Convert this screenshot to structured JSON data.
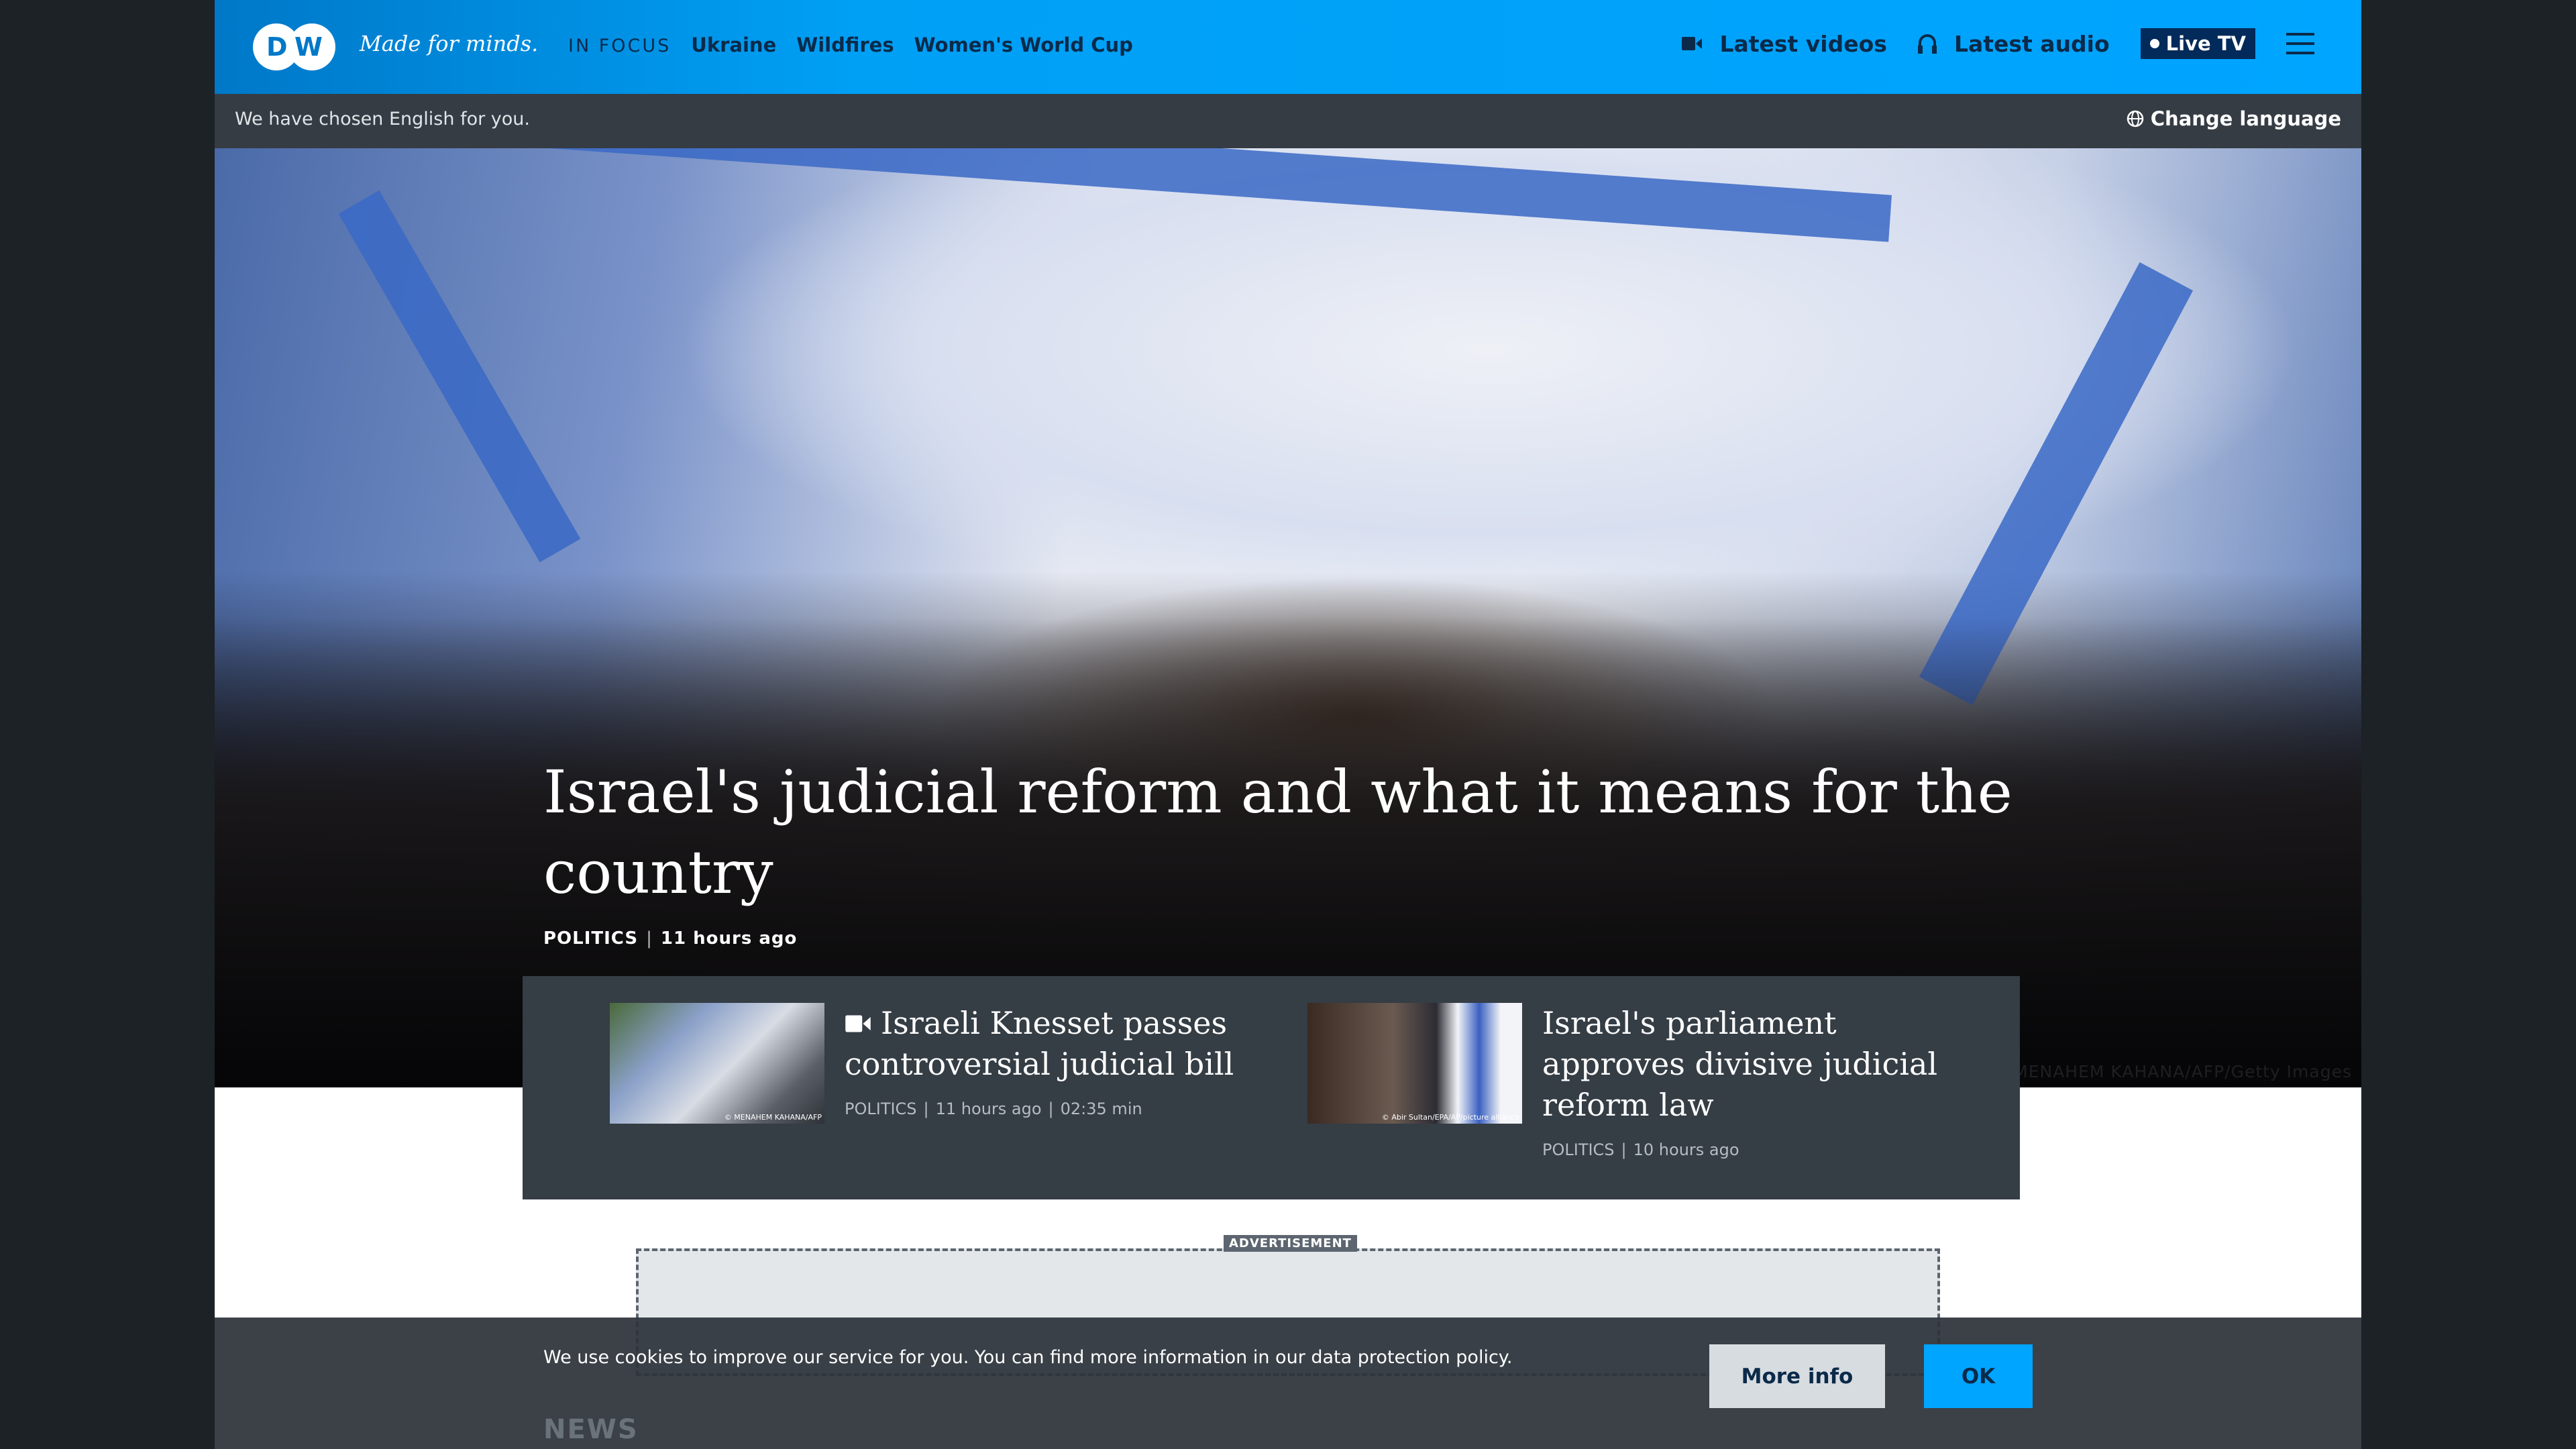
{
  "header": {
    "tagline": "Made for minds.",
    "in_focus": "IN FOCUS",
    "nav": [
      "Ukraine",
      "Wildfires",
      "Women's World Cup"
    ],
    "latest_videos": "Latest videos",
    "latest_audio": "Latest audio",
    "live_tv": "Live TV",
    "brand_color": "#00a5ff"
  },
  "language_bar": {
    "message": "We have chosen English for you.",
    "change_language": "Change language"
  },
  "hero": {
    "title": "Israel's judicial reform and what it means for the country",
    "category": "POLITICS",
    "separator": "|",
    "time": "11 hours ago",
    "credit": "© MENAHEM KAHANA/AFP/Getty Images"
  },
  "cards": [
    {
      "title": "Israeli Knesset passes controversial judicial bill",
      "category": "POLITICS",
      "time": "11 hours ago",
      "duration": "02:35 min",
      "image_credit": "© MENAHEM KAHANA/AFP",
      "has_video": true
    },
    {
      "title": "Israel's parliament approves divisive judicial reform law",
      "category": "POLITICS",
      "time": "10 hours ago",
      "image_credit": "© Abir Sultan/EPA/AP/picture alliance"
    }
  ],
  "ad": {
    "label": "ADVERTISEMENT"
  },
  "cookie": {
    "text": "We use cookies to improve our service for you. You can find more information in our data protection policy.",
    "more_info": "More info",
    "ok": "OK"
  },
  "section": {
    "news": "NEWS"
  }
}
